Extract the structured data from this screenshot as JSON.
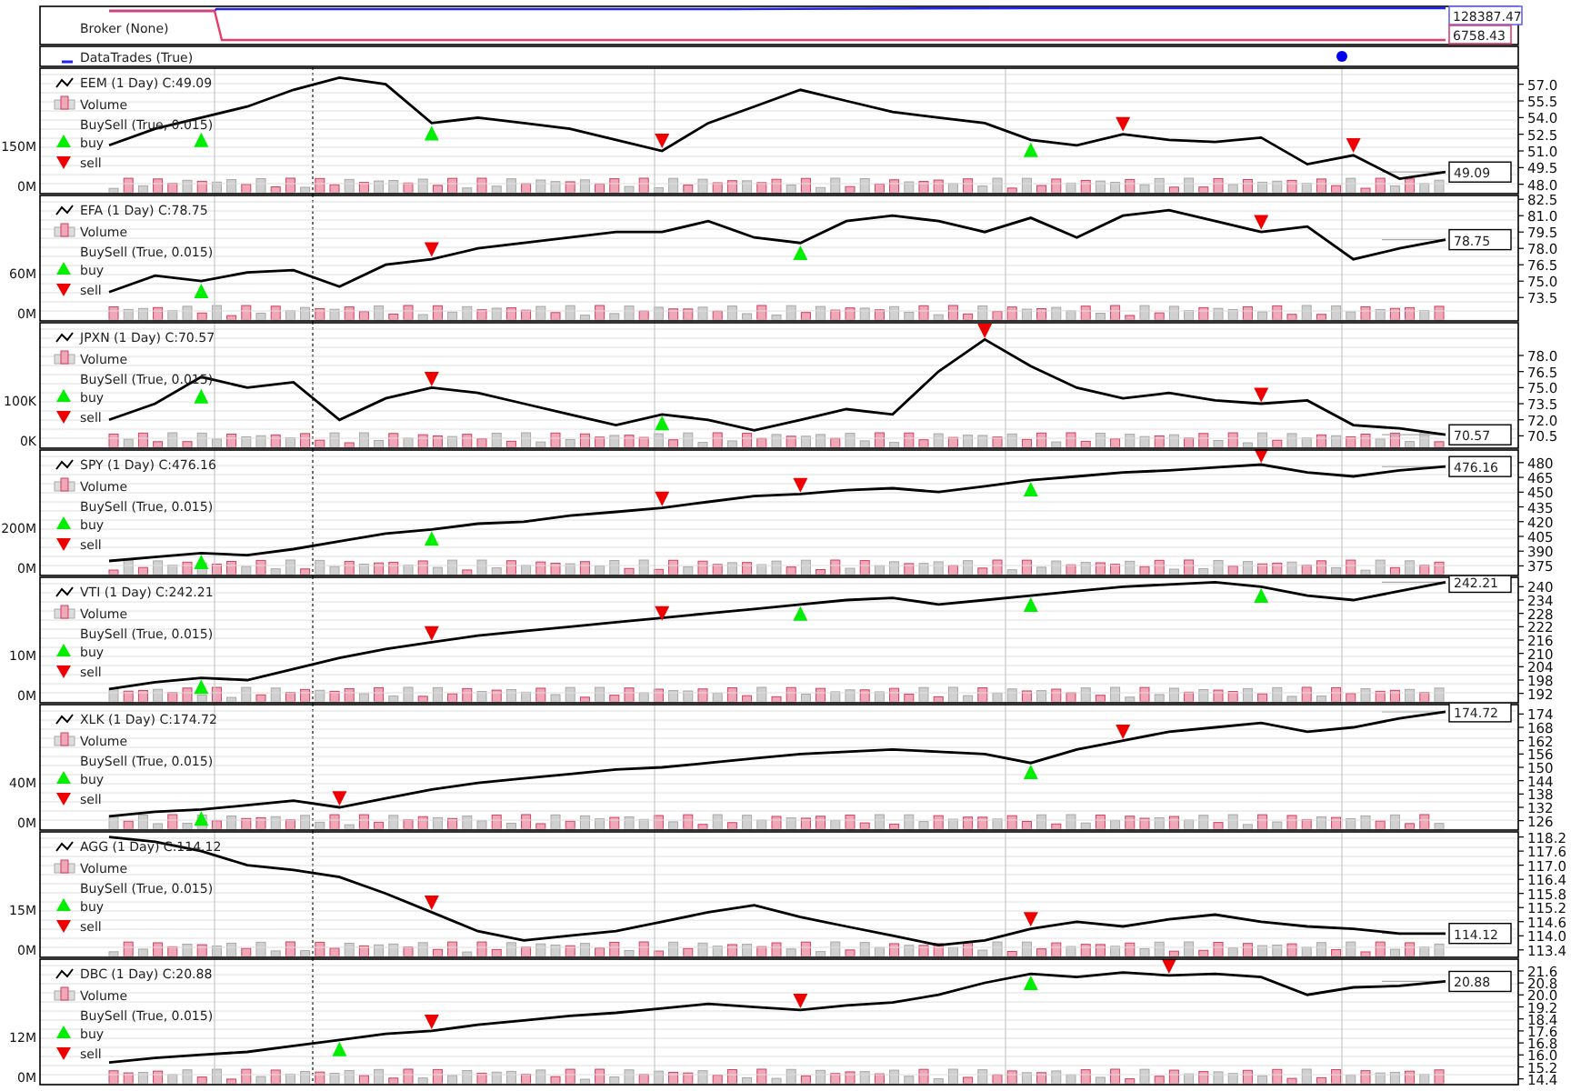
{
  "broker": {
    "label": "Broker (None)",
    "value_label": "128387.47",
    "cash_label": "6758.43"
  },
  "data_trades": {
    "label": "DataTrades (True)"
  },
  "panels": [
    {
      "legend": {
        "volume": "Volume",
        "buysell": "BuySell (True, 0.015)"
      },
      "last_label": "49.09",
      "volume_ticks": [
        "150M",
        "0M"
      ],
      "chart_data": {
        "type": "line",
        "grid": true,
        "ylim": [
          47.4,
          58.2
        ],
        "yticks": [
          {
            "value": 57,
            "label": "57.0"
          },
          {
            "value": 55.5,
            "label": "55.5"
          },
          {
            "value": 54,
            "label": "54.0"
          },
          {
            "value": 52.5,
            "label": "52.5"
          },
          {
            "value": 51,
            "label": "51.0"
          },
          {
            "value": 49.5,
            "label": "49.5"
          },
          {
            "value": 48,
            "label": "48.0"
          }
        ],
        "series": [
          {
            "name": "EEM (1 Day) C:49.09",
            "color": "#000000",
            "values": [
              51.5,
              53,
              54,
              55,
              56.5,
              57.6,
              57,
              53.5,
              54,
              53.5,
              53,
              52,
              51,
              53.5,
              55,
              56.5,
              55.5,
              54.5,
              54,
              53.5,
              52,
              51.5,
              52.5,
              52,
              51.8,
              52.2,
              49.8,
              50.6,
              48.5,
              49.1
            ]
          },
          {
            "name": "buy",
            "type": "scatter",
            "color": "#00ee00",
            "values": [
              null,
              null,
              52.0,
              null,
              null,
              null,
              null,
              52.6,
              null,
              null,
              null,
              null,
              null,
              null,
              null,
              null,
              null,
              null,
              null,
              null,
              51.1,
              null,
              null,
              null,
              null,
              null,
              null,
              null,
              null,
              null
            ]
          },
          {
            "name": "sell",
            "type": "scatter",
            "color": "#ee0000",
            "values": [
              null,
              null,
              null,
              null,
              null,
              null,
              null,
              null,
              null,
              null,
              null,
              null,
              51.9,
              null,
              null,
              null,
              null,
              null,
              null,
              null,
              null,
              null,
              53.4,
              null,
              null,
              null,
              null,
              51.5,
              null,
              null
            ]
          }
        ]
      }
    },
    {
      "legend": {
        "volume": "Volume",
        "buysell": "BuySell (True, 0.015)"
      },
      "last_label": "78.75",
      "volume_ticks": [
        "60M",
        "0M"
      ],
      "chart_data": {
        "type": "line",
        "grid": true,
        "ylim": [
          71.6,
          82.6
        ],
        "yticks": [
          {
            "value": 82.5,
            "label": "82.5"
          },
          {
            "value": 81,
            "label": "81.0"
          },
          {
            "value": 79.5,
            "label": "79.5"
          },
          {
            "value": 78,
            "label": "78.0"
          },
          {
            "value": 76.5,
            "label": "76.5"
          },
          {
            "value": 75,
            "label": "75.0"
          },
          {
            "value": 73.5,
            "label": "73.5"
          }
        ],
        "series": [
          {
            "name": "EFA (1 Day) C:78.75",
            "color": "#000000",
            "values": [
              74,
              75.5,
              75,
              75.8,
              76,
              74.5,
              76.5,
              77,
              78,
              78.5,
              79,
              79.5,
              79.5,
              80.5,
              79,
              78.5,
              80.5,
              81,
              80.5,
              79.5,
              80.8,
              79,
              81,
              81.5,
              80.5,
              79.5,
              80,
              77,
              78,
              78.8
            ]
          },
          {
            "name": "buy",
            "type": "scatter",
            "color": "#00ee00",
            "values": [
              null,
              null,
              74.1,
              null,
              null,
              null,
              null,
              null,
              null,
              null,
              null,
              null,
              null,
              null,
              null,
              77.6,
              null,
              null,
              null,
              null,
              null,
              null,
              null,
              null,
              null,
              null,
              null,
              null,
              null,
              null
            ]
          },
          {
            "name": "sell",
            "type": "scatter",
            "color": "#ee0000",
            "values": [
              null,
              null,
              null,
              null,
              null,
              null,
              null,
              77.9,
              null,
              null,
              null,
              null,
              null,
              null,
              null,
              null,
              null,
              null,
              null,
              null,
              null,
              null,
              null,
              null,
              null,
              80.4,
              null,
              null,
              null,
              null
            ]
          }
        ]
      }
    },
    {
      "legend": {
        "volume": "Volume",
        "buysell": "BuySell (True, 0.015)"
      },
      "last_label": "70.57",
      "volume_ticks": [
        "100K",
        "0K"
      ],
      "chart_data": {
        "type": "line",
        "grid": true,
        "ylim": [
          69.6,
          80.8
        ],
        "yticks": [
          {
            "value": 78,
            "label": "78.0"
          },
          {
            "value": 76.5,
            "label": "76.5"
          },
          {
            "value": 75,
            "label": "75.0"
          },
          {
            "value": 73.5,
            "label": "73.5"
          },
          {
            "value": 72,
            "label": "72.0"
          },
          {
            "value": 70.5,
            "label": "70.5"
          }
        ],
        "series": [
          {
            "name": "JPXN (1 Day) C:70.57",
            "color": "#000000",
            "values": [
              72,
              73.5,
              76,
              75,
              75.5,
              72,
              74,
              75,
              74.5,
              73.5,
              72.5,
              71.5,
              72.5,
              72,
              71,
              72,
              73,
              72.5,
              76.5,
              79.5,
              77,
              75,
              74,
              74.5,
              73.8,
              73.5,
              73.8,
              71.5,
              71.2,
              70.6
            ]
          },
          {
            "name": "buy",
            "type": "scatter",
            "color": "#00ee00",
            "values": [
              null,
              null,
              74.2,
              null,
              null,
              null,
              null,
              null,
              null,
              null,
              null,
              null,
              71.7,
              null,
              null,
              null,
              null,
              null,
              null,
              null,
              null,
              null,
              null,
              null,
              null,
              null,
              null,
              null,
              null,
              null
            ]
          },
          {
            "name": "sell",
            "type": "scatter",
            "color": "#ee0000",
            "values": [
              null,
              null,
              null,
              null,
              null,
              null,
              null,
              75.8,
              null,
              null,
              null,
              null,
              null,
              null,
              null,
              null,
              null,
              null,
              null,
              80.3,
              null,
              null,
              null,
              null,
              null,
              74.3,
              null,
              null,
              null,
              null
            ]
          }
        ]
      }
    },
    {
      "legend": {
        "volume": "Volume",
        "buysell": "BuySell (True, 0.015)"
      },
      "last_label": "476.16",
      "volume_ticks": [
        "200M",
        "0M"
      ],
      "chart_data": {
        "type": "line",
        "grid": true,
        "ylim": [
          368,
          490
        ],
        "yticks": [
          480,
          465,
          450,
          435,
          420,
          405,
          390,
          375
        ],
        "series": [
          {
            "name": "SPY (1 Day) C:476.16",
            "color": "#000000",
            "values": [
              380,
              384,
              388,
              386,
              392,
              400,
              408,
              412,
              418,
              420,
              426,
              430,
              434,
              440,
              446,
              448,
              452,
              454,
              450,
              456,
              462,
              466,
              470,
              472,
              475,
              478,
              470,
              466,
              472,
              476
            ]
          },
          {
            "name": "buy",
            "type": "scatter",
            "color": "#00ee00",
            "values": [
              null,
              null,
              379,
              null,
              null,
              null,
              null,
              403,
              null,
              null,
              null,
              null,
              null,
              null,
              null,
              null,
              null,
              null,
              null,
              null,
              453,
              null,
              null,
              null,
              null,
              null,
              null,
              null,
              null,
              null
            ]
          },
          {
            "name": "sell",
            "type": "scatter",
            "color": "#ee0000",
            "values": [
              null,
              null,
              null,
              null,
              null,
              null,
              null,
              null,
              null,
              null,
              null,
              null,
              443,
              null,
              null,
              457,
              null,
              null,
              null,
              null,
              null,
              null,
              null,
              null,
              null,
              487,
              null,
              null,
              null,
              null
            ]
          }
        ]
      }
    },
    {
      "legend": {
        "volume": "Volume",
        "buysell": "BuySell (True, 0.015)"
      },
      "last_label": "242.21",
      "volume_ticks": [
        "10M",
        "0M"
      ],
      "chart_data": {
        "type": "line",
        "grid": true,
        "ylim": [
          189,
          243
        ],
        "yticks": [
          240,
          234,
          228,
          222,
          216,
          210,
          204,
          198,
          192
        ],
        "series": [
          {
            "name": "VTI (1 Day) C:242.21",
            "color": "#000000",
            "values": [
              194,
              197,
              199,
              198,
              203,
              208,
              212,
              215,
              218,
              220,
              222,
              224,
              226,
              228,
              230,
              232,
              234,
              235,
              232,
              234,
              236,
              238,
              240,
              241,
              242,
              240,
              236,
              234,
              238,
              242
            ]
          },
          {
            "name": "buy",
            "type": "scatter",
            "color": "#00ee00",
            "values": [
              null,
              null,
              195,
              null,
              null,
              null,
              null,
              null,
              null,
              null,
              null,
              null,
              null,
              null,
              null,
              228,
              null,
              null,
              null,
              null,
              232,
              null,
              null,
              null,
              null,
              236,
              null,
              null,
              null,
              null
            ]
          },
          {
            "name": "sell",
            "type": "scatter",
            "color": "#ee0000",
            "values": [
              null,
              null,
              null,
              null,
              null,
              null,
              null,
              219,
              null,
              null,
              null,
              null,
              228,
              null,
              null,
              null,
              null,
              null,
              null,
              null,
              null,
              null,
              null,
              null,
              null,
              null,
              null,
              null,
              null,
              null
            ]
          }
        ]
      }
    },
    {
      "legend": {
        "volume": "Volume",
        "buysell": "BuySell (True, 0.015)"
      },
      "last_label": "174.72",
      "volume_ticks": [
        "40M",
        "0M"
      ],
      "chart_data": {
        "type": "line",
        "grid": true,
        "ylim": [
          123,
          177
        ],
        "yticks": [
          174,
          168,
          162,
          156,
          150,
          144,
          138,
          132,
          126
        ],
        "series": [
          {
            "name": "XLK (1 Day) C:174.72",
            "color": "#000000",
            "values": [
              128,
              130,
              131,
              133,
              135,
              132,
              136,
              140,
              143,
              145,
              147,
              149,
              150,
              152,
              154,
              156,
              157,
              158,
              157,
              156,
              152,
              158,
              162,
              166,
              168,
              170,
              166,
              168,
              172,
              175
            ]
          },
          {
            "name": "buy",
            "type": "scatter",
            "color": "#00ee00",
            "values": [
              null,
              null,
              127,
              null,
              null,
              null,
              null,
              null,
              null,
              null,
              null,
              null,
              null,
              null,
              null,
              null,
              null,
              null,
              null,
              null,
              148,
              null,
              null,
              null,
              null,
              null,
              null,
              null,
              null,
              null
            ]
          },
          {
            "name": "sell",
            "type": "scatter",
            "color": "#ee0000",
            "values": [
              null,
              null,
              null,
              null,
              null,
              136,
              null,
              null,
              null,
              null,
              null,
              null,
              null,
              null,
              null,
              null,
              null,
              null,
              null,
              null,
              null,
              null,
              166,
              null,
              null,
              null,
              null,
              null,
              null,
              null
            ]
          }
        ]
      }
    },
    {
      "legend": {
        "volume": "Volume",
        "buysell": "BuySell (True, 0.015)"
      },
      "last_label": "114.12",
      "volume_ticks": [
        "15M",
        "0M"
      ],
      "chart_data": {
        "type": "line",
        "grid": true,
        "ylim": [
          113.2,
          118.3
        ],
        "yticks": [
          {
            "value": 118.2,
            "label": "118.2"
          },
          {
            "value": 117.6,
            "label": "117.6"
          },
          {
            "value": 117,
            "label": "117.0"
          },
          {
            "value": 116.4,
            "label": "116.4"
          },
          {
            "value": 115.8,
            "label": "115.8"
          },
          {
            "value": 115.2,
            "label": "115.2"
          },
          {
            "value": 114.6,
            "label": "114.6"
          },
          {
            "value": 114,
            "label": "114.0"
          },
          {
            "value": 113.4,
            "label": "113.4"
          }
        ],
        "series": [
          {
            "name": "AGG (1 Day) C:114.12",
            "color": "#000000",
            "values": [
              118.2,
              118.0,
              117.6,
              117.0,
              116.8,
              116.5,
              115.8,
              115,
              114.2,
              113.8,
              114.0,
              114.2,
              114.6,
              115,
              115.3,
              114.8,
              114.4,
              114.0,
              113.6,
              113.8,
              114.3,
              114.6,
              114.4,
              114.7,
              114.9,
              114.6,
              114.4,
              114.3,
              114.1,
              114.1
            ]
          },
          {
            "name": "buy",
            "type": "scatter",
            "color": "#00ee00",
            "values": [
              null,
              null,
              null,
              null,
              null,
              null,
              null,
              null,
              null,
              null,
              null,
              null,
              null,
              null,
              null,
              null,
              null,
              null,
              null,
              null,
              null,
              null,
              null,
              null,
              null,
              null,
              null,
              null,
              null,
              null
            ]
          },
          {
            "name": "sell",
            "type": "scatter",
            "color": "#ee0000",
            "values": [
              null,
              null,
              null,
              null,
              null,
              null,
              null,
              115.4,
              null,
              null,
              null,
              null,
              null,
              null,
              null,
              null,
              null,
              null,
              null,
              null,
              114.7,
              null,
              null,
              null,
              null,
              null,
              null,
              null,
              null,
              null
            ]
          }
        ]
      }
    },
    {
      "legend": {
        "volume": "Volume",
        "buysell": "BuySell (True, 0.015)"
      },
      "last_label": "20.88",
      "volume_ticks": [
        "12M",
        "0M"
      ],
      "chart_data": {
        "type": "line",
        "grid": true,
        "ylim": [
          14.2,
          22.2
        ],
        "yticks": [
          {
            "value": 21.6,
            "label": "21.6"
          },
          {
            "value": 20.8,
            "label": "20.8"
          },
          {
            "value": 20,
            "label": "20.0"
          },
          {
            "value": 19.2,
            "label": "19.2"
          },
          {
            "value": 18.4,
            "label": "18.4"
          },
          {
            "value": 17.6,
            "label": "17.6"
          },
          {
            "value": 16.8,
            "label": "16.8"
          },
          {
            "value": 16,
            "label": "16.0"
          },
          {
            "value": 15.2,
            "label": "15.2"
          },
          {
            "value": 14.4,
            "label": "14.4"
          }
        ],
        "series": [
          {
            "name": "DBC (1 Day) C:20.88",
            "color": "#000000",
            "values": [
              15.5,
              15.8,
              16.0,
              16.2,
              16.6,
              17,
              17.4,
              17.6,
              18.0,
              18.3,
              18.6,
              18.8,
              19.1,
              19.4,
              19.2,
              19.0,
              19.3,
              19.5,
              20,
              20.8,
              21.4,
              21.2,
              21.5,
              21.3,
              21.4,
              21.2,
              20.0,
              20.5,
              20.6,
              20.9
            ]
          },
          {
            "name": "buy",
            "type": "scatter",
            "color": "#00ee00",
            "values": [
              null,
              null,
              null,
              null,
              null,
              16.4,
              null,
              null,
              null,
              null,
              null,
              null,
              null,
              null,
              null,
              null,
              null,
              null,
              null,
              null,
              20.8,
              null,
              null,
              null,
              null,
              null,
              null,
              null,
              null,
              null
            ]
          },
          {
            "name": "sell",
            "type": "scatter",
            "color": "#ee0000",
            "values": [
              null,
              null,
              null,
              null,
              null,
              null,
              null,
              18.2,
              null,
              null,
              null,
              null,
              null,
              null,
              null,
              19.6,
              null,
              null,
              null,
              null,
              null,
              null,
              null,
              21.9,
              null,
              null,
              null,
              null,
              null,
              null
            ]
          }
        ]
      }
    }
  ]
}
